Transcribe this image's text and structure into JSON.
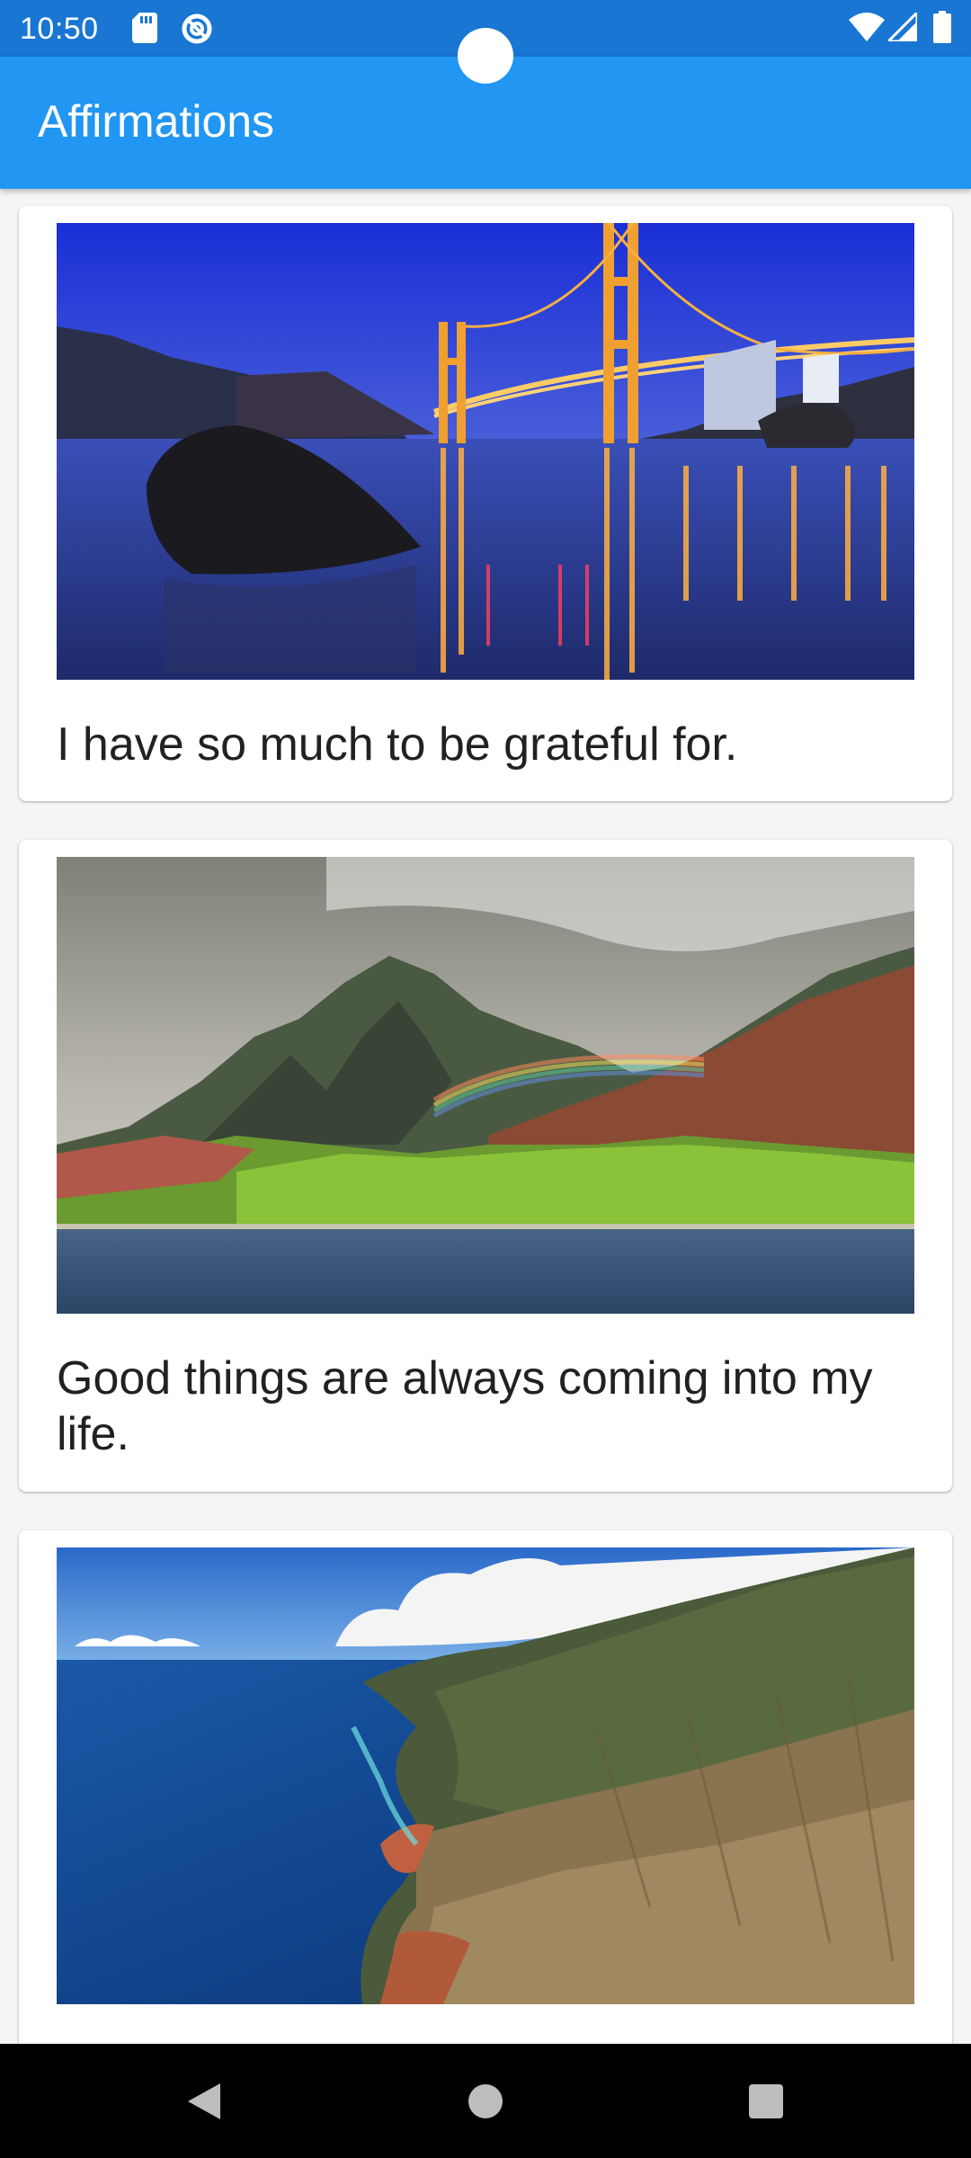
{
  "status_bar": {
    "time": "10:50",
    "icons": [
      "sd-card-icon",
      "data-saver-icon",
      "wifi-icon",
      "cellular-signal-icon",
      "battery-icon"
    ]
  },
  "app_bar": {
    "title": "Affirmations"
  },
  "affirmations": [
    {
      "text": "I have so much to be grateful for.",
      "image": "golden-gate-bridge-night-image"
    },
    {
      "text": "Good things are always coming into my life.",
      "image": "mountain-rainbow-coast-image"
    },
    {
      "text": "",
      "image": "aerial-coastline-cliffs-image"
    }
  ],
  "nav_bar": {
    "buttons": [
      "back-icon",
      "home-icon",
      "recents-icon"
    ]
  },
  "colors": {
    "status_bar": "#1976d2",
    "app_bar": "#2196f3",
    "background": "#f5f5f5",
    "card": "#ffffff",
    "text": "#212121",
    "nav_bar": "#000000"
  }
}
